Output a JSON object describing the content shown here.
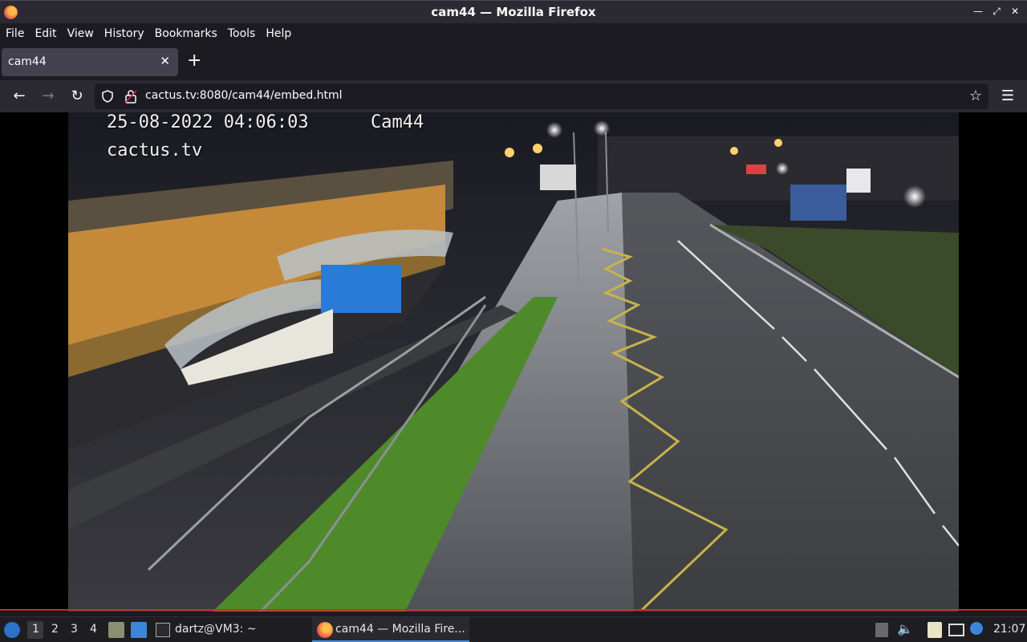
{
  "window": {
    "title": "cam44 — Mozilla Firefox"
  },
  "menu": [
    "File",
    "Edit",
    "View",
    "History",
    "Bookmarks",
    "Tools",
    "Help"
  ],
  "tab": {
    "label": "cam44"
  },
  "url": "cactus.tv:8080/cam44/embed.html",
  "video": {
    "timestamp": "25-08-2022 04:06:03",
    "camera": "Cam44",
    "brand": "cactus.tv"
  },
  "taskbar": {
    "workspaces": [
      "1",
      "2",
      "3",
      "4"
    ],
    "terminal_label": "dartz@VM3: ~",
    "firefox_label": "cam44 — Mozilla Fire...",
    "clock": "21:07"
  },
  "colors": {
    "accent": "#0a84ff",
    "progress": "#d32b2b"
  }
}
